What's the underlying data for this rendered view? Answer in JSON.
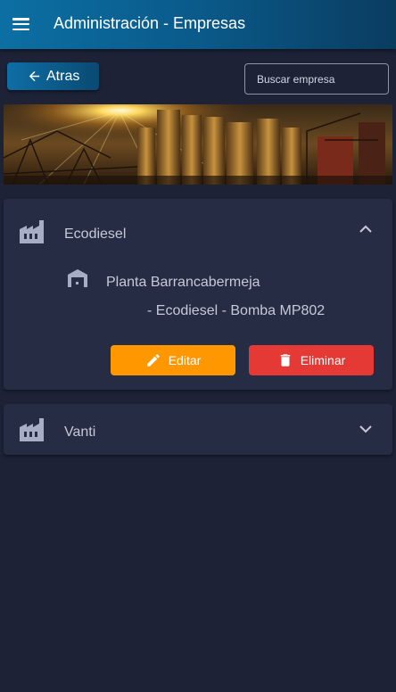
{
  "appbar": {
    "title": "Administración - Empresas",
    "menu_icon": "hamburger-menu-icon"
  },
  "toolbar": {
    "back_label": "Atras",
    "back_icon": "arrow-left-icon"
  },
  "search": {
    "placeholder": "Buscar empresa",
    "value": ""
  },
  "banner": {
    "image": "industrial-silos-sunset"
  },
  "companies": [
    {
      "name": "Ecodiesel",
      "icon": "factory-icon",
      "expanded": true,
      "plants": [
        {
          "name": "Planta Barrancabermeja",
          "detail": "- Ecodiesel - Bomba MP802",
          "icon": "warehouse-icon"
        }
      ],
      "actions": {
        "edit_label": "Editar",
        "delete_label": "Eliminar"
      }
    },
    {
      "name": "Vanti",
      "icon": "factory-icon",
      "expanded": false
    }
  ],
  "colors": {
    "background": "#1d2237",
    "card": "#262c43",
    "appbar_start": "#0c6fa3",
    "appbar_end": "#0a3c60",
    "edit": "#ff9800",
    "delete": "#e53935",
    "icon": "#a6adc4"
  }
}
